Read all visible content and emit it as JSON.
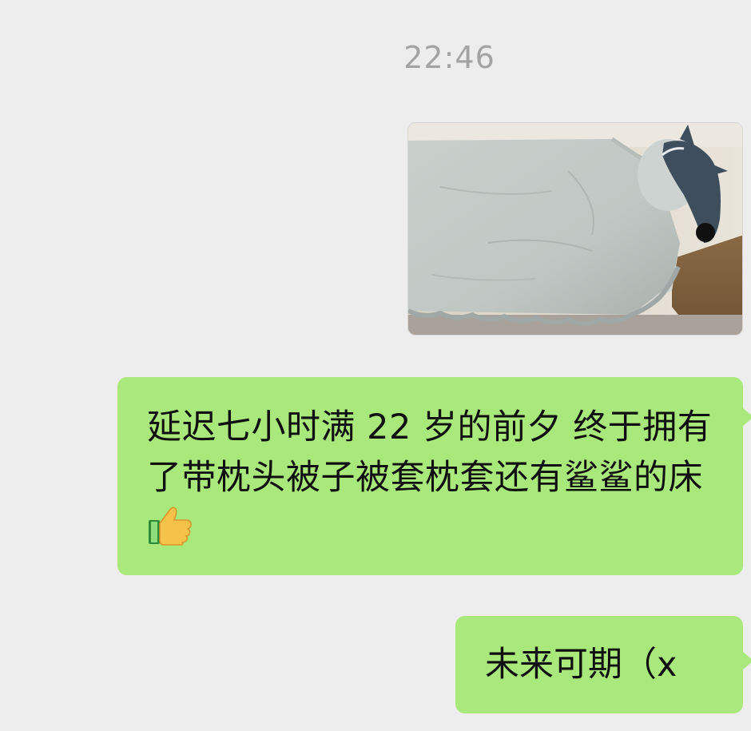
{
  "conversation": {
    "timestamp": "22:46",
    "messages": [
      {
        "type": "image",
        "content_hint": "photo of a bed with light blue-grey ruffled duvet cover and a plush shark toy"
      },
      {
        "type": "text",
        "text": "延迟七小时满 22 岁的前夕 终于拥有了带枕头被子被套枕套还有鲨鲨的床",
        "trailing_emoji": "thumbs-up-icon"
      },
      {
        "type": "text",
        "text": "未来可期（x"
      }
    ]
  },
  "colors": {
    "background": "#ededed",
    "sent_bubble": "#a9e87a",
    "timestamp_text": "#a3a3a3",
    "message_text": "#0f0f0f"
  }
}
